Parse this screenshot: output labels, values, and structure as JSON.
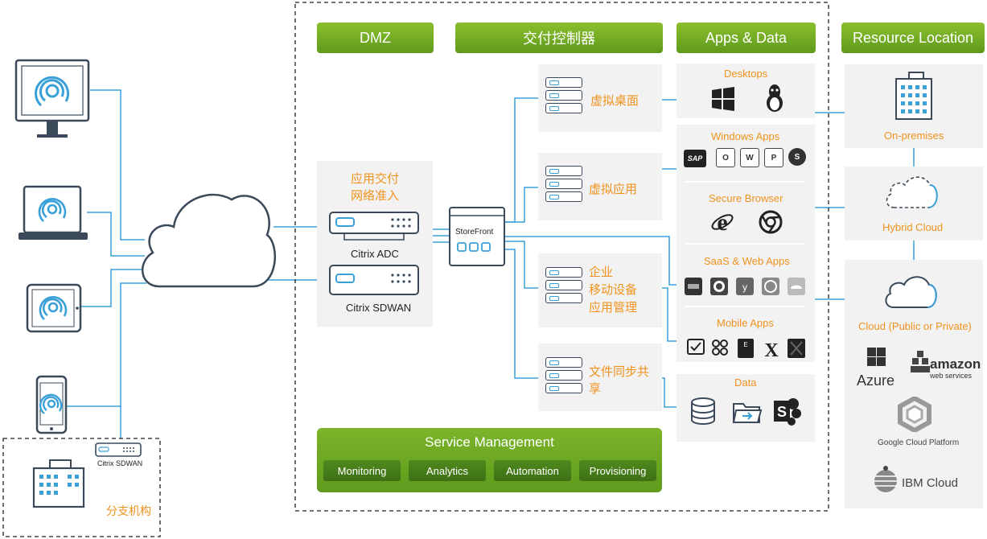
{
  "headers": {
    "dmz": "DMZ",
    "controller": "交付控制器",
    "apps": "Apps & Data",
    "resource": "Resource Location"
  },
  "dmz_panel": {
    "title_line1": "应用交付",
    "title_line2": "网络准入",
    "adc": "Citrix ADC",
    "sdwan": "Citrix SDWAN"
  },
  "storefront": "StoreFront",
  "controllers": [
    {
      "label": "虚拟桌面"
    },
    {
      "label": "虚拟应用"
    },
    {
      "label_line1": "企业",
      "label_line2": "移动设备",
      "label_line3": "应用管理"
    },
    {
      "label_line1": "文件同步共",
      "label_line2": "享"
    }
  ],
  "apps": {
    "desktops": "Desktops",
    "windows_apps": "Windows Apps",
    "secure_browser": "Secure Browser",
    "saas": "SaaS & Web Apps",
    "mobile": "Mobile Apps",
    "data": "Data"
  },
  "app_icons": {
    "sap": "SAP",
    "outlook": "O",
    "word": "W",
    "powerpoint": "P",
    "skype": "S"
  },
  "resource": {
    "onprem": "On-premises",
    "hybrid": "Hybrid Cloud",
    "cloud": "Cloud (Public or Private)",
    "azure": "Azure",
    "amazon": "amazon",
    "aws": "web services",
    "google": "Google Cloud Platform",
    "ibm": "IBM Cloud"
  },
  "branch": {
    "label": "分支机构",
    "device": "Citrix SDWAN"
  },
  "service": {
    "title": "Service Management",
    "buttons": [
      "Monitoring",
      "Analytics",
      "Automation",
      "Provisioning"
    ]
  },
  "colors": {
    "green": "#6aa624",
    "orange": "#f0921e",
    "blue": "#3aa0d8",
    "dark": "#3a4a5a"
  }
}
